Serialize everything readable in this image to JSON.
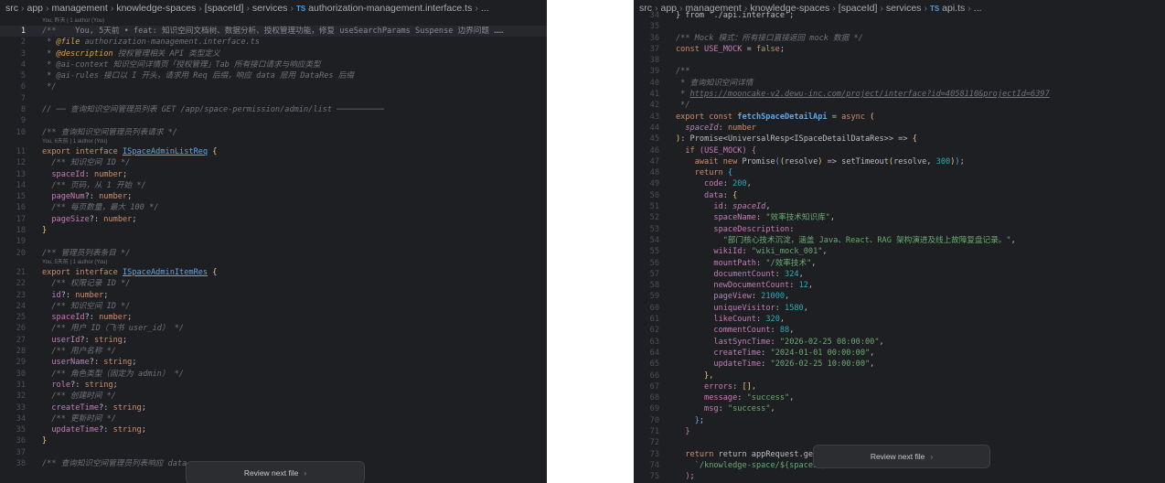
{
  "left": {
    "breadcrumb": {
      "segments": [
        "src",
        "app",
        "management",
        "knowledge-spaces",
        "[spaceId]",
        "services"
      ],
      "ts_badge": "TS",
      "file": "authorization-management.interface.ts",
      "more": "..."
    },
    "code_lens": {
      "top": "You, 昨天 | 1 author (You)",
      "req": "You, 6天前 | 1 author (You)",
      "item": "You, 5天前 | 1 author (You)"
    },
    "blame_line1": "You, 5天前 • feat: 知识空间文档树、数据分析、授权管理功能，修复 useSearchParams Suspense 边界问题 ……",
    "lines": {
      "l2_tag": "@file",
      "l2_text": "authorization-management.interface.ts",
      "l3_tag": "@description",
      "l3_text": "授权管理相关 API 类型定义",
      "l4_text": "@ai-context 知识空间详情页「授权管理」Tab 所有接口请求与响应类型",
      "l5_text": "@ai-rules 接口以 I 开头，请求用 Req 后缀，响应 data 层用 DataRes 后缀",
      "l8_comment": "// ── 查询知识空间管理员列表 GET /app/space-permission/admin/list ──────────",
      "l10_comment": "/** 查询知识空间管理员列表请求 */",
      "req_name": "ISpaceAdminListReq",
      "c_spaceid": "/** 知识空间 ID */",
      "c_pagenum": "/** 页码，从 1 开始 */",
      "c_pagesize": "/** 每页数量，最大 100 */",
      "l20_comment": "/** 管理员列表条目 */",
      "item_name": "ISpaceAdminItemRes",
      "c_id": "/** 权限记录 ID */",
      "c_userid": "/** 用户 ID（飞书 user_id） */",
      "c_username": "/** 用户名称 */",
      "c_role": "/** 角色类型（固定为 admin） */",
      "c_create": "/** 创建时间 */",
      "c_update": "/** 更新时间 */",
      "l38_comment": "/** 查询知识空间管理员列表响应 data"
    },
    "review_label": "Review next file"
  },
  "right": {
    "breadcrumb": {
      "segments": [
        "src",
        "app",
        "management",
        "knowledge-spaces",
        "[spaceId]",
        "services"
      ],
      "ts_badge": "TS",
      "file": "api.ts",
      "more": "..."
    },
    "lines": {
      "l34": "} from './api.interface';",
      "l36": "/** Mock 模式：所有接口直接返回 mock 数据 */",
      "l40": "* 查询知识空间详情",
      "l41_url": "https://mooncake-v2.dewu-inc.com/project/interface?id=4058110&projectId=6397",
      "fn_name": "fetchSpaceDetailApi",
      "resp_type": "Promise<UniversalResp<ISpaceDetailDataRes>>",
      "space_name": "\"效率技术知识库\"",
      "space_desc": "\"部门核心技术沉淀，涵盖 Java、React、RAG 架构演进及线上故障复盘记录。\"",
      "wiki_id": "\"wiki_mock_001\"",
      "mount_path": "\"/效率技术\"",
      "document_count": "324",
      "new_document_count": "12",
      "page_view": "21000",
      "unique_visitor": "1580",
      "like_count": "320",
      "comment_count": "88",
      "last_sync_time": "\"2026-02-25 08:00:00\"",
      "create_time": "\"2024-01-01 00:00:00\"",
      "update_time": "\"2026-02-25 10:00:00\"",
      "message": "\"success\"",
      "msg": "\"success\"",
      "l73": "return appRequest.get<Universa",
      "l74": "`/knowledge-space/${spaceId}"
    },
    "review_label": "Review next file"
  },
  "icons": {
    "breadcrumb_separator": "chevron-right-icon",
    "review_chevron": "chevron-right-icon"
  }
}
